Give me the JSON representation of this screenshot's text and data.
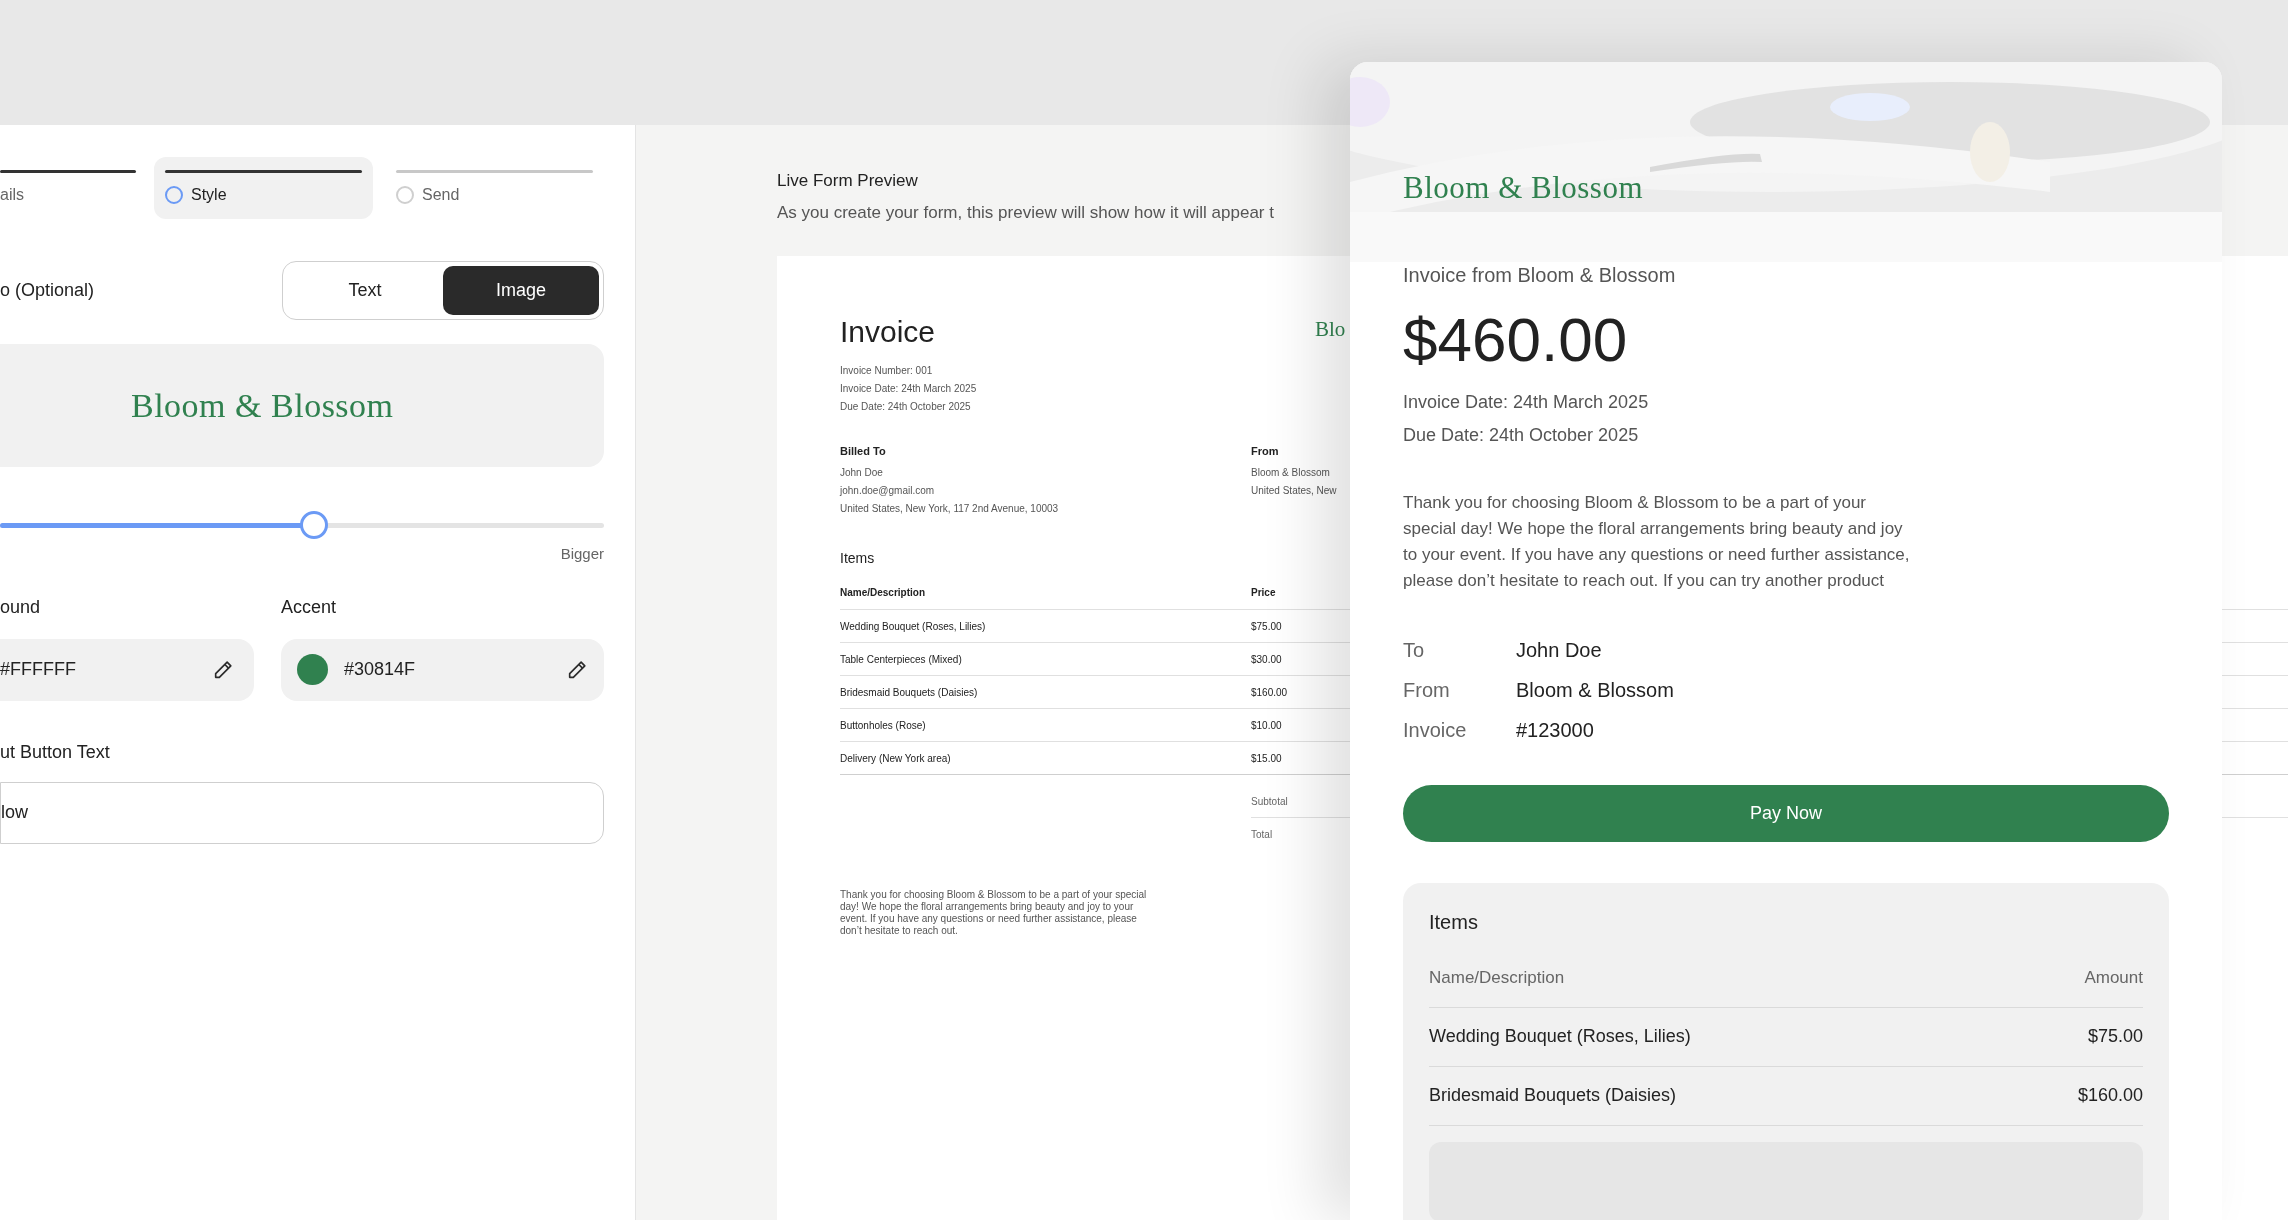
{
  "stepper": {
    "steps": [
      {
        "label": "ails",
        "selected": false,
        "completed": true
      },
      {
        "label": "Style",
        "selected": true,
        "completed": false
      },
      {
        "label": "Send",
        "selected": false,
        "completed": false
      }
    ]
  },
  "logo_section": {
    "label": "o (Optional)",
    "mode_options": [
      {
        "label": "Text",
        "selected": false
      },
      {
        "label": "Image",
        "selected": true
      }
    ],
    "logo": "Bloom & Blossom"
  },
  "size_slider": {
    "level": 0.52,
    "max_label": "Bigger"
  },
  "colors": [
    {
      "label": "ound",
      "value": "#FFFFFF"
    },
    {
      "label": "Accent",
      "value": "#30814F",
      "color": "#30814f"
    }
  ],
  "button_text": {
    "label": "ut Button Text",
    "value": "low"
  },
  "preview": {
    "title": "Live Form Preview",
    "subtitle": "As you create your form, this preview will show how it will appear t",
    "document": {
      "heading": "Invoice",
      "logo": "Blo",
      "meta": [
        "Invoice Number: 001",
        "Invoice Date: 24th March 2025",
        "Due Date: 24th October 2025"
      ],
      "billed_to": {
        "label": "Billed To",
        "lines": [
          "John Doe",
          "john.doe@gmail.com",
          "United States, New York, 117 2nd Avenue, 10003"
        ]
      },
      "from": {
        "label": "From",
        "lines": [
          "Bloom & Blossom",
          "United States, New"
        ]
      },
      "items_title": "Items",
      "columns": [
        "Name/Description",
        "Price"
      ],
      "rows": [
        {
          "name": "Wedding Bouquet (Roses, Lilies)",
          "price": "$75.00"
        },
        {
          "name": "Table Centerpieces (Mixed)",
          "price": "$30.00"
        },
        {
          "name": "Bridesmaid Bouquets (Daisies)",
          "price": "$160.00"
        },
        {
          "name": "Buttonholes (Rose)",
          "price": "$10.00"
        },
        {
          "name": "Delivery (New York area)",
          "price": "$15.00"
        }
      ],
      "totals": [
        "Subtotal",
        "Total"
      ],
      "note": "Thank you for choosing Bloom & Blossom to be a part of your special day! We hope the floral arrangements bring beauty and joy to your event. If you have any questions or need further assistance, please don’t hesitate to reach out."
    }
  },
  "invoice_card": {
    "logo": "Bloom & Blossom",
    "from_line": "Invoice from Bloom & Blossom",
    "amount": "$460.00",
    "dates": [
      "Invoice Date: 24th March 2025",
      "Due Date: 24th October 2025"
    ],
    "message": "Thank you for choosing Bloom & Blossom to be a part of your special day! We hope the floral arrangements bring beauty and joy to your event. If you have any questions or need further assistance, please don’t hesitate to reach out. If you can try another product",
    "details": [
      {
        "label": "To",
        "value": "John Doe"
      },
      {
        "label": "From",
        "value": "Bloom & Blossom"
      },
      {
        "label": "Invoice",
        "value": "#123000"
      }
    ],
    "pay_button": "Pay Now",
    "items": {
      "title": "Items",
      "columns": [
        "Name/Description",
        "Amount"
      ],
      "rows": [
        {
          "name": "Wedding Bouquet (Roses, Lilies)",
          "amount": "$75.00"
        },
        {
          "name": "Bridesmaid Bouquets (Daisies)",
          "amount": "$160.00"
        }
      ]
    }
  }
}
